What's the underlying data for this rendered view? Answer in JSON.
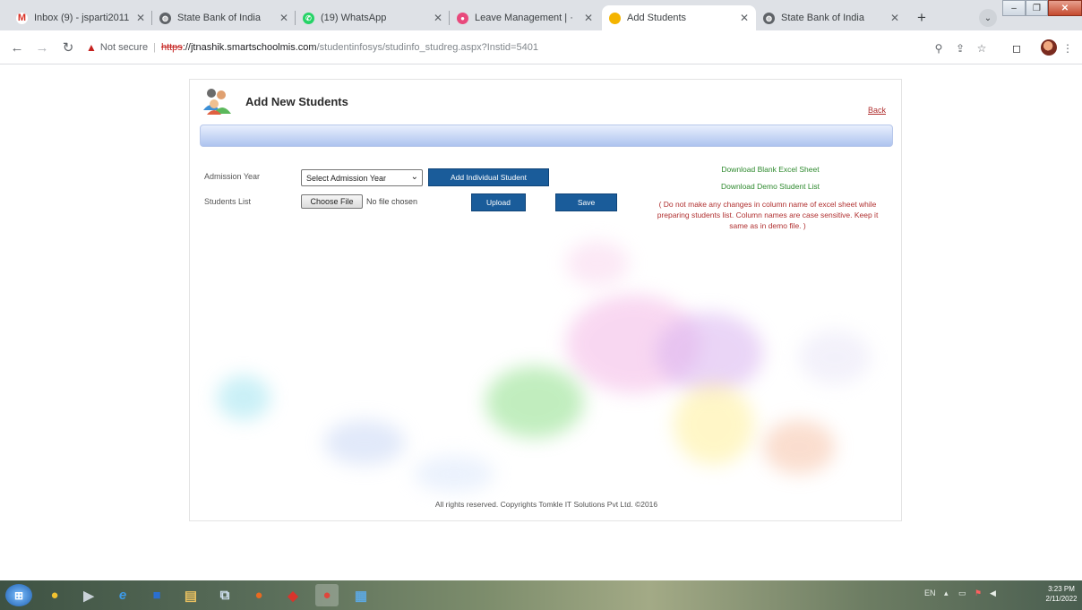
{
  "browser": {
    "tabs": [
      {
        "title": "Inbox (9) - jsparti2011",
        "icon": "gmail-icon",
        "color": "#d93025"
      },
      {
        "title": "State Bank of India",
        "icon": "globe-icon",
        "color": "#5f6368"
      },
      {
        "title": "(19) WhatsApp",
        "icon": "whatsapp-icon",
        "color": "#25d366"
      },
      {
        "title": "Leave Management | ·",
        "icon": "app-icon",
        "color": "#e8497c"
      },
      {
        "title": "Add Students",
        "icon": "loading-icon",
        "color": "#f4b400"
      },
      {
        "title": "State Bank of India",
        "icon": "globe-icon",
        "color": "#5f6368"
      }
    ],
    "active_tab": 4,
    "new_tab": "+",
    "address": {
      "security": "Not secure",
      "scheme": "https",
      "host": "://jtnashik.smartschoolmis.com",
      "path": "/studentinfosys/studinfo_studreg.aspx?Instid=5401"
    }
  },
  "page": {
    "title": "Add New Students",
    "back_link": "Back",
    "admission_year_label": "Admission Year",
    "admission_year_select": "Select Admission Year",
    "add_individual_button": "Add Individual Student",
    "students_list_label": "Students List",
    "choose_file_button": "Choose File",
    "no_file_text": "No file chosen",
    "upload_button": "Upload",
    "save_button": "Save",
    "download_blank_link": "Download Blank Excel Sheet",
    "download_demo_link": "Download Demo Student List",
    "note": "( Do not make any changes in column name of excel sheet while preparing students list. Column names are case sensitive. Keep it same as in demo file. )",
    "footer": "All rights reserved. Copyrights Tomkle IT Solutions Pvt Ltd. ©2016"
  },
  "taskbar": {
    "apps": [
      "start-orb",
      "chrome",
      "media-player",
      "internet-explorer",
      "outlook",
      "file-explorer",
      "network",
      "firefox",
      "acrobat",
      "chrome-active",
      "control-panel"
    ],
    "tray_lang": "EN",
    "time": "3:23 PM",
    "date": "2/11/2022"
  }
}
